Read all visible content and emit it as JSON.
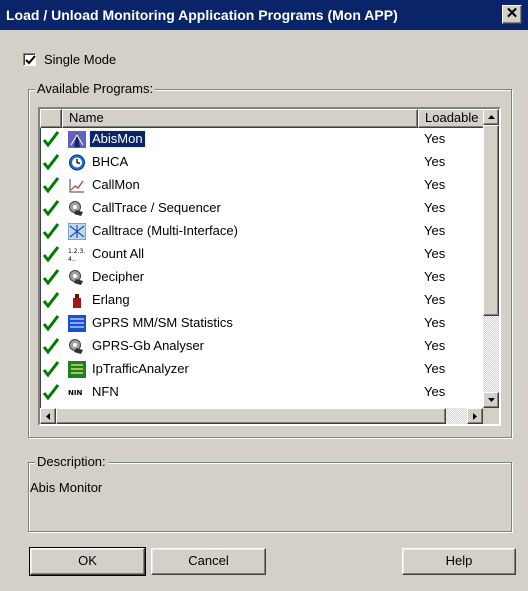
{
  "window": {
    "title": "Load / Unload Monitoring Application Programs (Mon APP)",
    "close_label": "✕"
  },
  "single_mode": {
    "label": "Single Mode",
    "checked": true
  },
  "available_programs": {
    "group_label": "Available Programs:",
    "columns": [
      "Name",
      "Loadable"
    ],
    "rows": [
      {
        "name": "AbisMon",
        "loadable": "Yes",
        "icon": "abismon-icon",
        "selected": true
      },
      {
        "name": "BHCA",
        "loadable": "Yes",
        "icon": "clock-icon"
      },
      {
        "name": "CallMon",
        "loadable": "Yes",
        "icon": "chart-icon"
      },
      {
        "name": "CallTrace / Sequencer",
        "loadable": "Yes",
        "icon": "phone-gear-icon"
      },
      {
        "name": "Calltrace (Multi-Interface)",
        "loadable": "Yes",
        "icon": "network-icon"
      },
      {
        "name": "Count All",
        "loadable": "Yes",
        "icon": "count-icon"
      },
      {
        "name": "Decipher",
        "loadable": "Yes",
        "icon": "phone-gear-icon"
      },
      {
        "name": "Erlang",
        "loadable": "Yes",
        "icon": "weight-icon"
      },
      {
        "name": "GPRS MM/SM Statistics",
        "loadable": "Yes",
        "icon": "statistics-icon"
      },
      {
        "name": "GPRS-Gb Analyser",
        "loadable": "Yes",
        "icon": "phone-gear-icon"
      },
      {
        "name": "IpTrafficAnalyzer",
        "loadable": "Yes",
        "icon": "traffic-icon"
      },
      {
        "name": "NFN",
        "loadable": "Yes",
        "icon": "nfn-icon"
      }
    ]
  },
  "description": {
    "group_label": "Description:",
    "text": "Abis Monitor"
  },
  "buttons": {
    "ok": "OK",
    "cancel": "Cancel",
    "help": "Help"
  },
  "colors": {
    "title_bar": "#0a246a",
    "face": "#d4d0c8",
    "check": "#007a00"
  }
}
